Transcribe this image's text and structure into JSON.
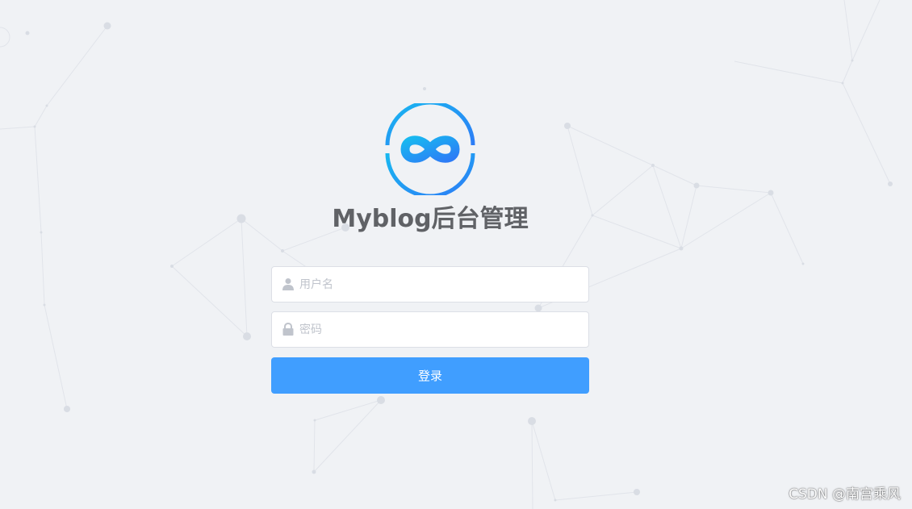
{
  "login": {
    "title": "Myblog后台管理",
    "username_placeholder": "用户名",
    "password_placeholder": "密码",
    "login_label": "登录"
  },
  "icons": {
    "logo": "infinity-logo-icon",
    "username": "user-icon",
    "password": "lock-icon"
  },
  "watermark": "CSDN @南宫乘风",
  "colors": {
    "background": "#f0f2f5",
    "primary": "#409eff",
    "title": "#606266",
    "placeholder": "#c0c4cc",
    "logo_gradient_start": "#18b8f0",
    "logo_gradient_end": "#2d7cf6"
  }
}
